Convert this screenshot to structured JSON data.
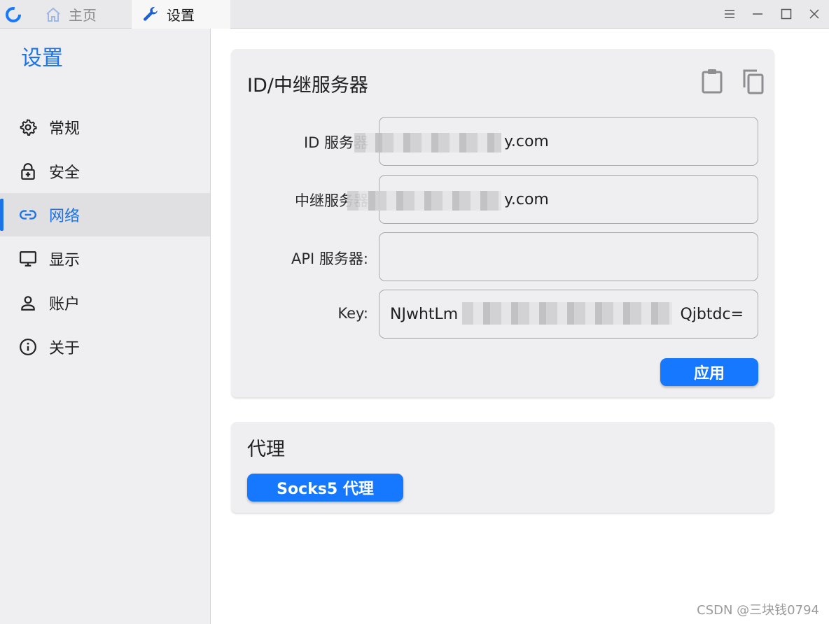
{
  "titlebar": {
    "tabs": [
      {
        "label": "主页",
        "icon": "home-icon"
      },
      {
        "label": "设置",
        "icon": "wrench-icon"
      }
    ],
    "window_controls": [
      "menu-icon",
      "minimize-icon",
      "maximize-icon",
      "close-icon"
    ]
  },
  "sidebar": {
    "title": "设置",
    "items": [
      {
        "label": "常规",
        "icon": "gear-icon"
      },
      {
        "label": "安全",
        "icon": "lock-icon"
      },
      {
        "label": "网络",
        "icon": "link-icon",
        "active": true
      },
      {
        "label": "显示",
        "icon": "monitor-icon"
      },
      {
        "label": "账户",
        "icon": "person-icon"
      },
      {
        "label": "关于",
        "icon": "info-icon"
      }
    ]
  },
  "id_relay": {
    "title": "ID/中继服务器",
    "rows": [
      {
        "label": "ID 服务器",
        "value": "y.com"
      },
      {
        "label": "中继服务器",
        "value": "y.com"
      },
      {
        "label": "API 服务器:",
        "value": ""
      },
      {
        "label": "Key:",
        "value_start": "NJwhtLm",
        "value_end": "Qjbtdc="
      }
    ],
    "apply_label": "应用"
  },
  "proxy": {
    "title": "代理",
    "socks5_label": "Socks5 代理"
  },
  "watermark": "CSDN @三块钱0794",
  "colors": {
    "accent": "#1a73e8",
    "button": "#1677ff",
    "sidebar_bg": "#efeff2",
    "card_bg": "#efeff2"
  }
}
